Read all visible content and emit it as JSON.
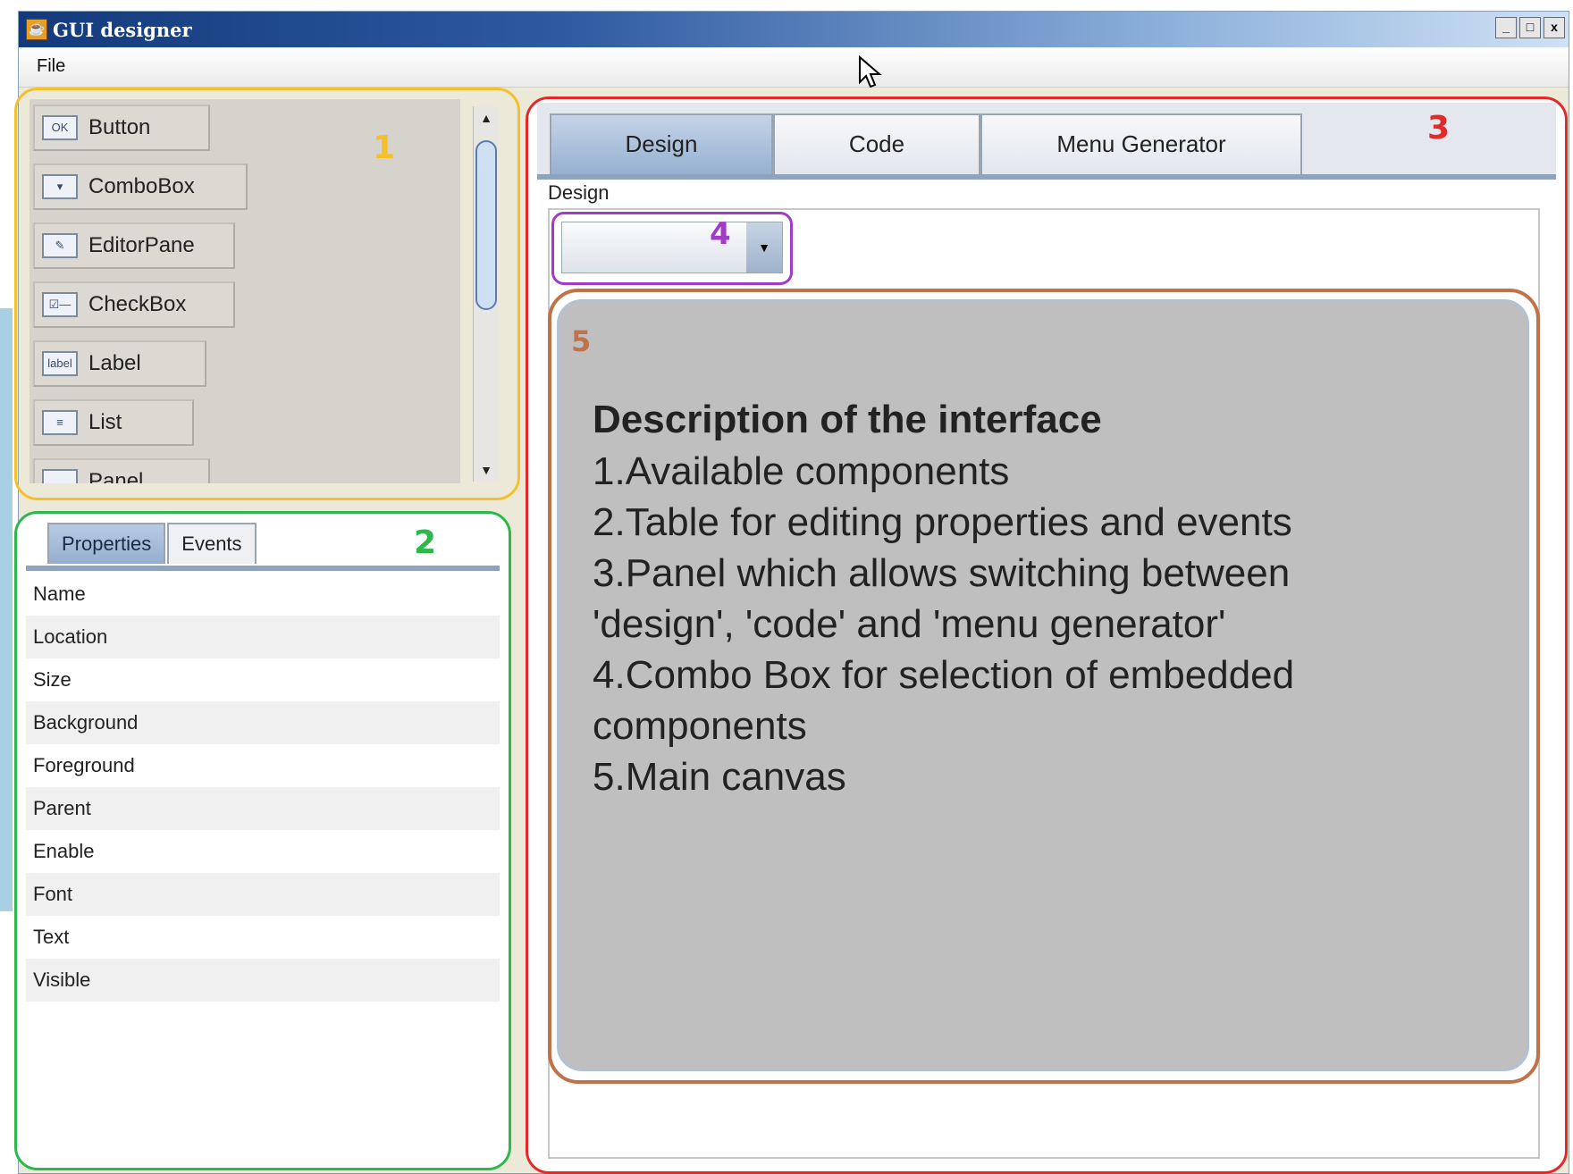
{
  "window": {
    "title": "GUI designer",
    "controls": {
      "minimize": "_",
      "maximize": "□",
      "close": "x"
    }
  },
  "menu": {
    "file": "File"
  },
  "markers": {
    "m1": "1",
    "m2": "2",
    "m3": "3",
    "m4": "4",
    "m5": "5"
  },
  "palette": {
    "items": [
      {
        "icon_text": "OK",
        "label": "Button"
      },
      {
        "icon_text": "▾",
        "label": "ComboBox"
      },
      {
        "icon_text": "✎",
        "label": "EditorPane"
      },
      {
        "icon_text": "☑—",
        "label": "CheckBox"
      },
      {
        "icon_text": "label",
        "label": "Label"
      },
      {
        "icon_text": "≡",
        "label": "List"
      },
      {
        "icon_text": "",
        "label": "Panel"
      }
    ]
  },
  "properties": {
    "tabs": [
      "Properties",
      "Events"
    ],
    "rows": [
      "Name",
      "Location",
      "Size",
      "Background",
      "Foreground",
      "Parent",
      "Enable",
      "Font",
      "Text",
      "Visible"
    ]
  },
  "main": {
    "tabs": [
      "Design",
      "Code",
      "Menu Generator"
    ],
    "design_label": "Design",
    "combo_value": "",
    "canvas": {
      "title": "Description of the interface",
      "lines": [
        "1.Available components",
        "2.Table for editing properties and events",
        "3.Panel which allows switching between",
        "'design', 'code' and 'menu generator'",
        "4.Combo Box for selection of embedded",
        "components",
        "5.Main canvas"
      ]
    }
  },
  "colors": {
    "marker1": "#f5c02a",
    "marker2": "#2cb84a",
    "marker3": "#e52828",
    "marker4": "#a23cc8",
    "marker5": "#c0734a"
  }
}
